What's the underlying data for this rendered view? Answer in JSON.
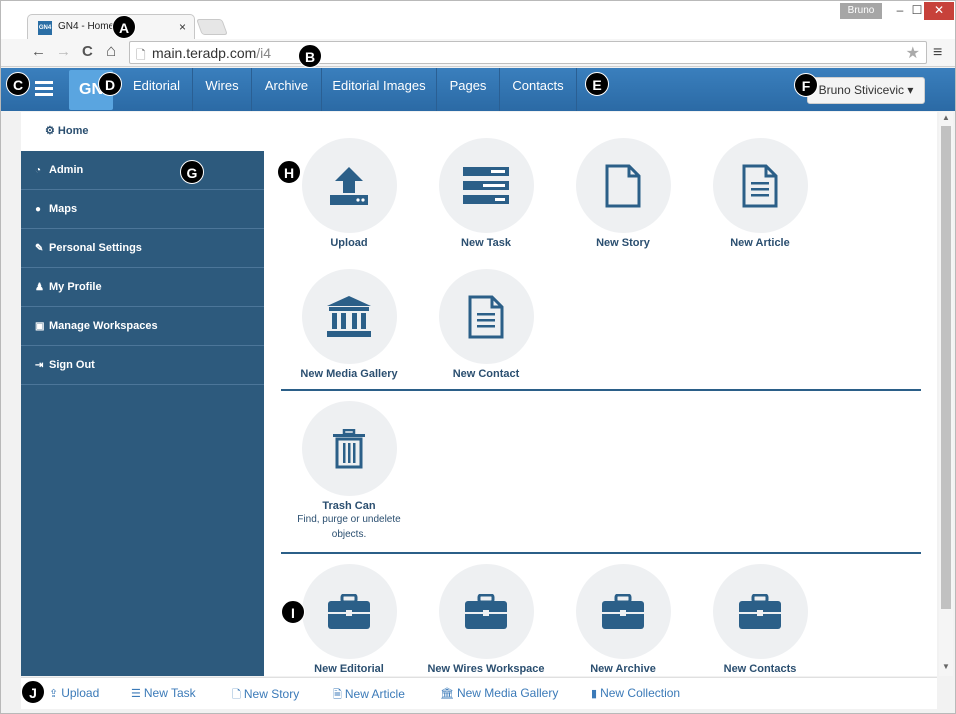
{
  "browser": {
    "tab_title": "GN4 - Home",
    "tab_close": "×",
    "favicon_text": "GN4",
    "window_user": "Bruno",
    "url_host": "main.teradp.com",
    "url_path": "/i4",
    "buttons": {
      "back": "←",
      "forward": "→",
      "reload": "C",
      "home": "⌂",
      "star": "★",
      "menu": "≡",
      "minimize": "–",
      "maximize": "☐",
      "close": "✕"
    }
  },
  "nav": {
    "logo": "GN",
    "items": [
      "Editorial",
      "Wires",
      "Archive",
      "Editorial Images",
      "Pages",
      "Contacts"
    ],
    "user_button": "Bruno Stivicevic ▾"
  },
  "breadcrumb": {
    "home": "Home"
  },
  "sidebar": {
    "items": [
      {
        "label": "Admin",
        "icon": "dashboard-icon"
      },
      {
        "label": "Maps",
        "icon": "globe-icon"
      },
      {
        "label": "Personal Settings",
        "icon": "pencil-icon"
      },
      {
        "label": "My Profile",
        "icon": "user-icon"
      },
      {
        "label": "Manage Workspaces",
        "icon": "briefcase-icon"
      },
      {
        "label": "Sign Out",
        "icon": "sign-out-icon"
      }
    ]
  },
  "tiles": {
    "upload": "Upload",
    "new_task": "New Task",
    "new_story": "New Story",
    "new_article": "New Article",
    "new_media_gallery": "New Media Gallery",
    "new_contact": "New Contact",
    "trash_can": "Trash Can",
    "trash_desc_1": "Find, purge or undelete",
    "trash_desc_2": "objects.",
    "new_editorial": "New Editorial",
    "new_wires_workspace": "New Wires Workspace",
    "new_archive": "New Archive",
    "new_contacts": "New Contacts"
  },
  "bottom": {
    "upload": "Upload",
    "new_task": "New Task",
    "new_story": "New Story",
    "new_article": "New Article",
    "new_media_gallery": "New Media Gallery",
    "new_collection": "New Collection"
  },
  "markers": [
    "A",
    "B",
    "C",
    "D",
    "E",
    "F",
    "G",
    "H",
    "I",
    "J"
  ],
  "colors": {
    "nav": "#2b6aa5",
    "sidebar": "#2d5a7d",
    "icon": "#2b5f88",
    "link": "#3b7ab8"
  }
}
